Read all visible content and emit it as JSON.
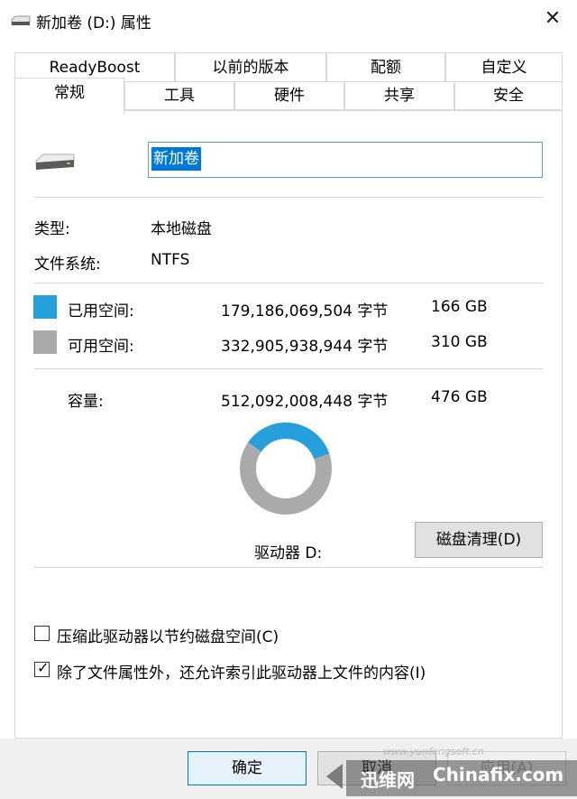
{
  "window": {
    "title": "新加卷 (D:) 属性",
    "close_symbol": "✕"
  },
  "tabs_row1": [
    {
      "label": "ReadyBoost"
    },
    {
      "label": "以前的版本"
    },
    {
      "label": "配额"
    },
    {
      "label": "自定义"
    }
  ],
  "tabs_row2": [
    {
      "label": "常规",
      "active": true
    },
    {
      "label": "工具"
    },
    {
      "label": "硬件"
    },
    {
      "label": "共享"
    },
    {
      "label": "安全"
    }
  ],
  "general": {
    "volume_name": "新加卷",
    "type_label": "类型:",
    "type_value": "本地磁盘",
    "fs_label": "文件系统:",
    "fs_value": "NTFS",
    "used": {
      "label": "已用空间:",
      "bytes": "179,186,069,504 字节",
      "size": "166 GB",
      "color": "#26a0da"
    },
    "free": {
      "label": "可用空间:",
      "bytes": "332,905,938,944 字节",
      "size": "310 GB",
      "color": "#aaaaaa"
    },
    "capacity": {
      "label": "容量:",
      "bytes": "512,092,008,448 字节",
      "size": "476 GB"
    },
    "used_fraction": 0.349,
    "drive_label": "驱动器 D:",
    "cleanup_button": "磁盘清理(D)",
    "compress_option": {
      "label": "压缩此驱动器以节约磁盘空间(C)",
      "checked": false
    },
    "index_option": {
      "label": "除了文件属性外，还允许索引此驱动器上文件的内容(I)",
      "checked": true
    }
  },
  "footer": {
    "ok": "确定",
    "cancel": "取消",
    "apply": "应用(A)"
  },
  "watermark": {
    "text_mid": "迅维网",
    "text_brand": "Chinafix.com",
    "text_sub": "www.yunfengsoft.cn"
  }
}
